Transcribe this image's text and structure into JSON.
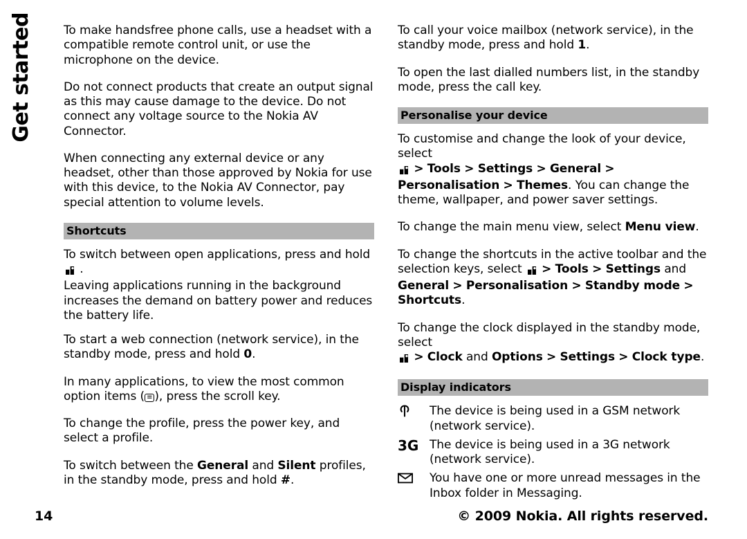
{
  "sideTitle": "Get started",
  "pageNumber": "14",
  "copyright": "© 2009 Nokia. All rights reserved.",
  "col1": {
    "p1": "To make handsfree phone calls, use a headset with a compatible remote control unit, or use the microphone on the device.",
    "p2": "Do not connect products that create an output signal as this may cause damage to the device. Do not connect any voltage source to the Nokia AV Connector.",
    "p3": "When connecting any external device or any headset, other than those approved by Nokia for use with this device, to the Nokia AV Connector, pay special attention to volume levels.",
    "sec1": "Shortcuts",
    "p4a": "To switch between open applications, press and hold",
    "p4b": " .",
    "p5": "Leaving applications running in the background increases the demand on battery power and reduces the battery life.",
    "p6a": "To start a web connection (network service), in the standby mode, press and hold ",
    "p6b": "0",
    "p6c": ".",
    "p7a": "In many applications, to view the most common option items (",
    "p7b": "), press the scroll key.",
    "p8": "To change the profile, press the power key, and select a profile.",
    "p9a": "To switch between the ",
    "p9b": "General",
    "p9c": " and ",
    "p9d": "Silent",
    "p9e": " profiles, in the standby mode, press and hold ",
    "p9f": "#",
    "p9g": "."
  },
  "col2": {
    "p1a": "To call your voice mailbox (network service), in the standby mode, press and hold ",
    "p1b": "1",
    "p1c": ".",
    "p2": "To open the last dialled numbers list, in the standby mode, press the call key.",
    "sec1": "Personalise your device",
    "p3a": "To customise and change the look of your device, select ",
    "p3path1": "Tools",
    "p3path2": "Settings",
    "p3path3": "General",
    "p3path4": "Personalisation",
    "p3path5": "Themes",
    "p3b": ". You can change the theme, wallpaper, and power saver settings.",
    "p4a": "To change the main menu view, select ",
    "p4b": "Menu view",
    "p4c": ".",
    "p5a": "To change the shortcuts in the active toolbar and the selection keys, select ",
    "p5b": "Tools",
    "p5c": "Settings",
    "p5d": " and ",
    "p5e": "General",
    "p5f": "Personalisation",
    "p5g": "Standby mode",
    "p5h": "Shortcuts",
    "p5i": ".",
    "p6a": "To change the clock displayed in the standby mode, select ",
    "p6b": "Clock",
    "p6c": " and ",
    "p6d": "Options",
    "p6e": "Settings",
    "p6f": "Clock type",
    "p6g": ".",
    "sec2": "Display indicators",
    "ind": [
      {
        "icon": "antenna",
        "label": "",
        "text": "The device is being used in a GSM network (network service)."
      },
      {
        "icon": "3g",
        "label": "3G",
        "text": "The device is being used in a 3G network (network service)."
      },
      {
        "icon": "envelope",
        "label": "",
        "text": "You have one or more unread messages in the Inbox folder in Messaging."
      }
    ]
  },
  "glyphs": {
    "gt": ">",
    "menuLines": "≡"
  }
}
